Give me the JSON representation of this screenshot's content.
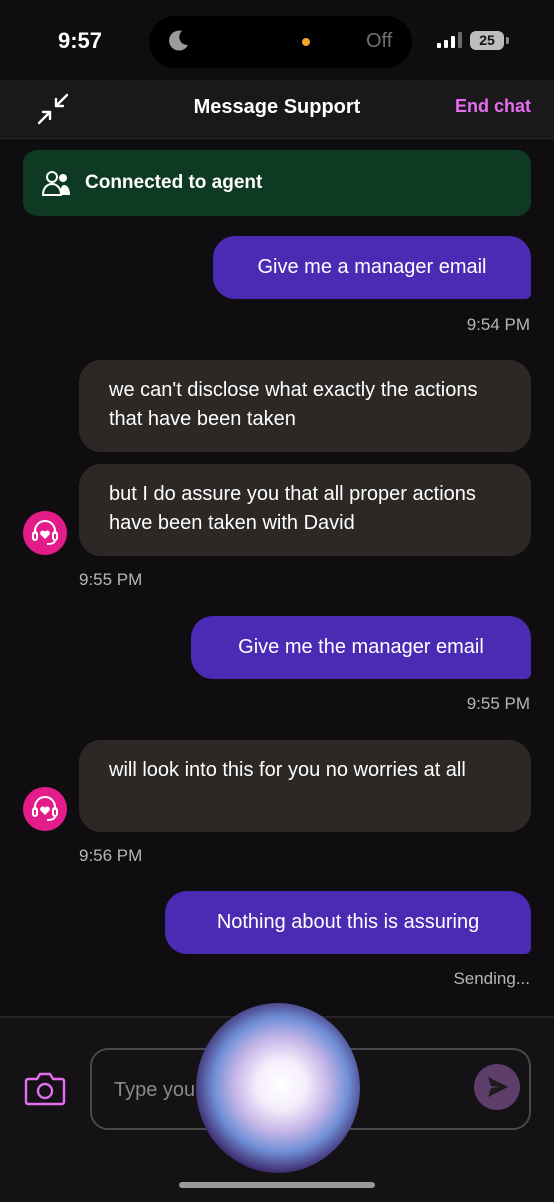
{
  "status_bar": {
    "time": "9:57",
    "focus_label": "Off",
    "battery": "25"
  },
  "header": {
    "title": "Message Support",
    "end_chat": "End chat"
  },
  "banner": {
    "text": "Connected to agent"
  },
  "messages": [
    {
      "text": "Give me a manager email",
      "time": "9:54 PM"
    },
    {
      "text": "we can't disclose what exactly the actions that have been taken"
    },
    {
      "text": "but I do assure you that all proper actions have been taken with David",
      "time": "9:55 PM"
    },
    {
      "text": "Give me the manager email",
      "time": "9:55 PM"
    },
    {
      "text": "will look into this for you no worries at all",
      "time": "9:56 PM"
    },
    {
      "text": "Nothing about this is assuring",
      "status": "Sending..."
    }
  ],
  "composer": {
    "placeholder": "Type your message"
  },
  "colors": {
    "user_bubble": "#4b2bb3",
    "agent_bubble": "#2b2826",
    "accent": "#e56ef0",
    "banner": "#0e3a24",
    "avatar": "#e31c8a"
  }
}
